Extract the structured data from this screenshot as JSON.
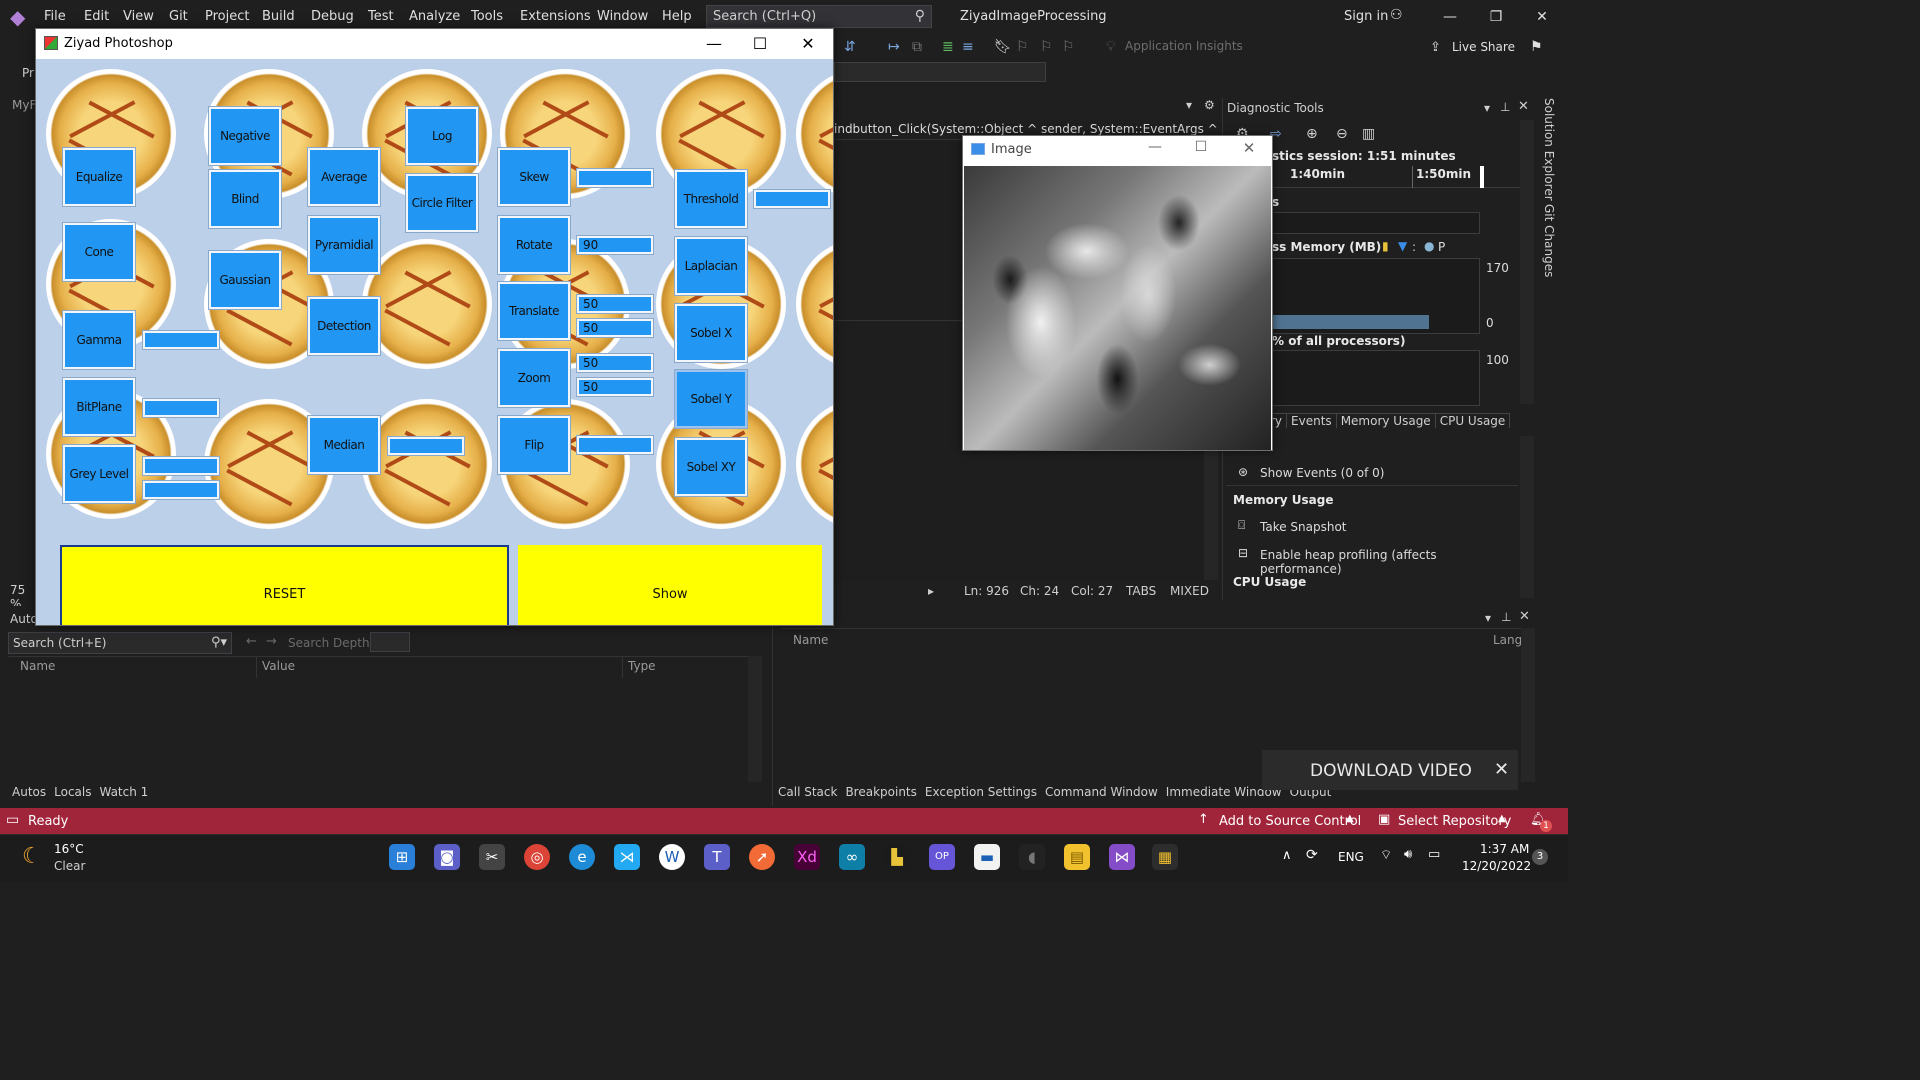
{
  "vs": {
    "menu": [
      "File",
      "Edit",
      "View",
      "Git",
      "Project",
      "Build",
      "Debug",
      "Test",
      "Analyze",
      "Tools",
      "Extensions",
      "Window",
      "Help"
    ],
    "search_placeholder": "Search (Ctrl+Q)",
    "solution_title": "ZiyadImageProcessing",
    "sign_in": "Sign in",
    "app_insights": "Application Insights",
    "live_share": "Live Share",
    "left_tab": "MyF",
    "editor_tab_text": "indbutton_Click(System::Object ^ sender, System::EventArgs ^ e)",
    "zoom": "75 %",
    "status_code": {
      "ln": "Ln: 926",
      "ch": "Ch: 24",
      "col": "Col: 27",
      "tabs": "TABS",
      "mixed": "MIXED"
    }
  },
  "diag": {
    "title": "Diagnostic Tools",
    "session": "stics session: 1:51 minutes",
    "t1": "1:40min",
    "t2": "1:50min",
    "events_s": "s",
    "memory_label": "ss Memory (MB)",
    "memory_legend": "P",
    "mem_max": "170",
    "mem_min": "0",
    "cpu_label": "% of all processors)",
    "cpu_max": "100",
    "tabs": [
      "ry",
      "Events",
      "Memory Usage",
      "CPU Usage"
    ],
    "show_events": "Show Events (0 of 0)",
    "memory_usage": "Memory Usage",
    "take_snapshot": "Take Snapshot",
    "heap_profiling": "Enable heap profiling (affects performance)",
    "cpu_usage": "CPU Usage"
  },
  "side_labels": [
    "Solution Explorer",
    "Git Changes"
  ],
  "autos": {
    "title": "Auto",
    "search_placeholder": "Search (Ctrl+E)",
    "search_depth": "Search Depth:",
    "columns": [
      "Name",
      "Value",
      "Type"
    ],
    "tabs": [
      "Autos",
      "Locals",
      "Watch 1"
    ]
  },
  "callstack": {
    "columns": [
      "Name",
      "Lang"
    ],
    "tabs": [
      "Call Stack",
      "Breakpoints",
      "Exception Settings",
      "Command Window",
      "Immediate Window",
      "Output"
    ]
  },
  "statusbar": {
    "ready": "Ready",
    "add_source": "Add to Source Control",
    "select_repo": "Select Repository",
    "notif_count": "1"
  },
  "taskbar": {
    "temp": "16°C",
    "weather": "Clear",
    "lang": "ENG",
    "time": "1:37 AM",
    "date": "12/20/2022",
    "badge": "3"
  },
  "photoshop": {
    "title": "Ziyad Photoshop",
    "buttons": {
      "equalize": "Equalize",
      "negative": "Negative",
      "blind": "Blind",
      "average": "Average",
      "log": "Log",
      "circle_filter": "Circle Filter",
      "skew": "Skew",
      "threshold": "Threshold",
      "cone": "Cone",
      "pyramidial": "Pyramidial",
      "gaussian": "Gaussian",
      "rotate": "Rotate",
      "laplacian": "Laplacian",
      "gamma": "Gamma",
      "detection": "Detection",
      "translate": "Translate",
      "sobel_x": "Sobel X",
      "zoom": "Zoom",
      "bitplane": "BitPlane",
      "sobel_y": "Sobel Y",
      "median": "Median",
      "flip": "Flip",
      "grey_level": "Grey Level",
      "sobel_xy": "Sobel XY",
      "reset": "RESET",
      "show": "Show"
    },
    "inputs": {
      "skew": "",
      "threshold": "",
      "rotate": "90",
      "translate_x": "50",
      "translate_y": "50",
      "zoom_x": "50",
      "zoom_y": "50",
      "flip": "",
      "gamma": "",
      "bitplane": "",
      "grey_1": "",
      "grey_2": "",
      "median": ""
    }
  },
  "image_window": {
    "title": "Image"
  },
  "download": {
    "label": "DOWNLOAD VIDEO"
  }
}
